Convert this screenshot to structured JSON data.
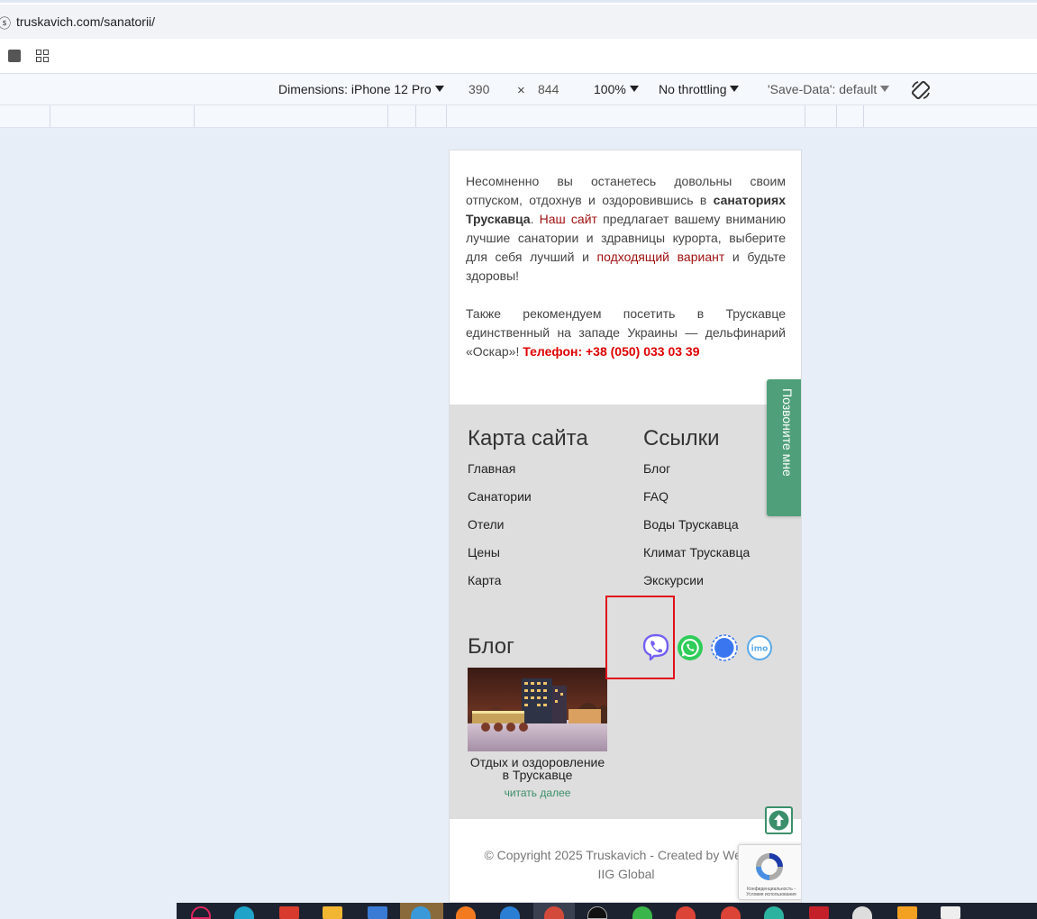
{
  "browser": {
    "url": "truskavich.com/sanatorii/"
  },
  "device_toolbar": {
    "dimensions_label": "Dimensions: iPhone 12 Pro",
    "width": "390",
    "times": "×",
    "height": "844",
    "zoom": "100%",
    "throttling": "No throttling",
    "save_data": "'Save-Data': default"
  },
  "content": {
    "p1_a": "Несомненно вы останетесь довольны своим отпуском, отдохнув и оздоровившись в ",
    "p1_bold": "санаториях Трускавца",
    "p1_b": ". ",
    "p1_link1": "Наш сайт",
    "p1_c": " предлагает вашему вниманию лучшие санатории и здравницы курорта, выберите для себя лучший и ",
    "p1_link2": "подходящий вариант",
    "p1_d": " и будьте здоровы!",
    "p2_a": "Также рекомендуем посетить в Трускавце единственный на западе Украины — дельфинарий «Оскар»! ",
    "p2_phone": "Телефон: +38 (050) 033 03 39"
  },
  "footer": {
    "sitemap_title": "Карта сайта",
    "sitemap_links": [
      "Главная",
      "Санатории",
      "Отели",
      "Цены",
      "Карта"
    ],
    "links_title": "Ссылки",
    "links_links": [
      "Блог",
      "FAQ",
      "Воды Трускавца",
      "Климат Трускавца",
      "Экскурсии"
    ],
    "blog_title": "Блог",
    "blog_caption": "Отдых и оздоровление в Трускавце",
    "read_more": "читать далее",
    "call_me": "Позвоните мне",
    "copyright_line1": "© Copyright 2025 Truskavich - Created by Web De",
    "copyright_line2": "IIG Global",
    "recaptcha_text": "Конфиденциальность - Условия использования",
    "messengers": [
      "viber-icon",
      "whatsapp-icon",
      "signal-icon",
      "imo-icon"
    ]
  },
  "colors": {
    "accent_green": "#4fa07a",
    "link_red": "#a01010",
    "phone_red": "#e00000",
    "highlight_box": "#e0101a"
  }
}
